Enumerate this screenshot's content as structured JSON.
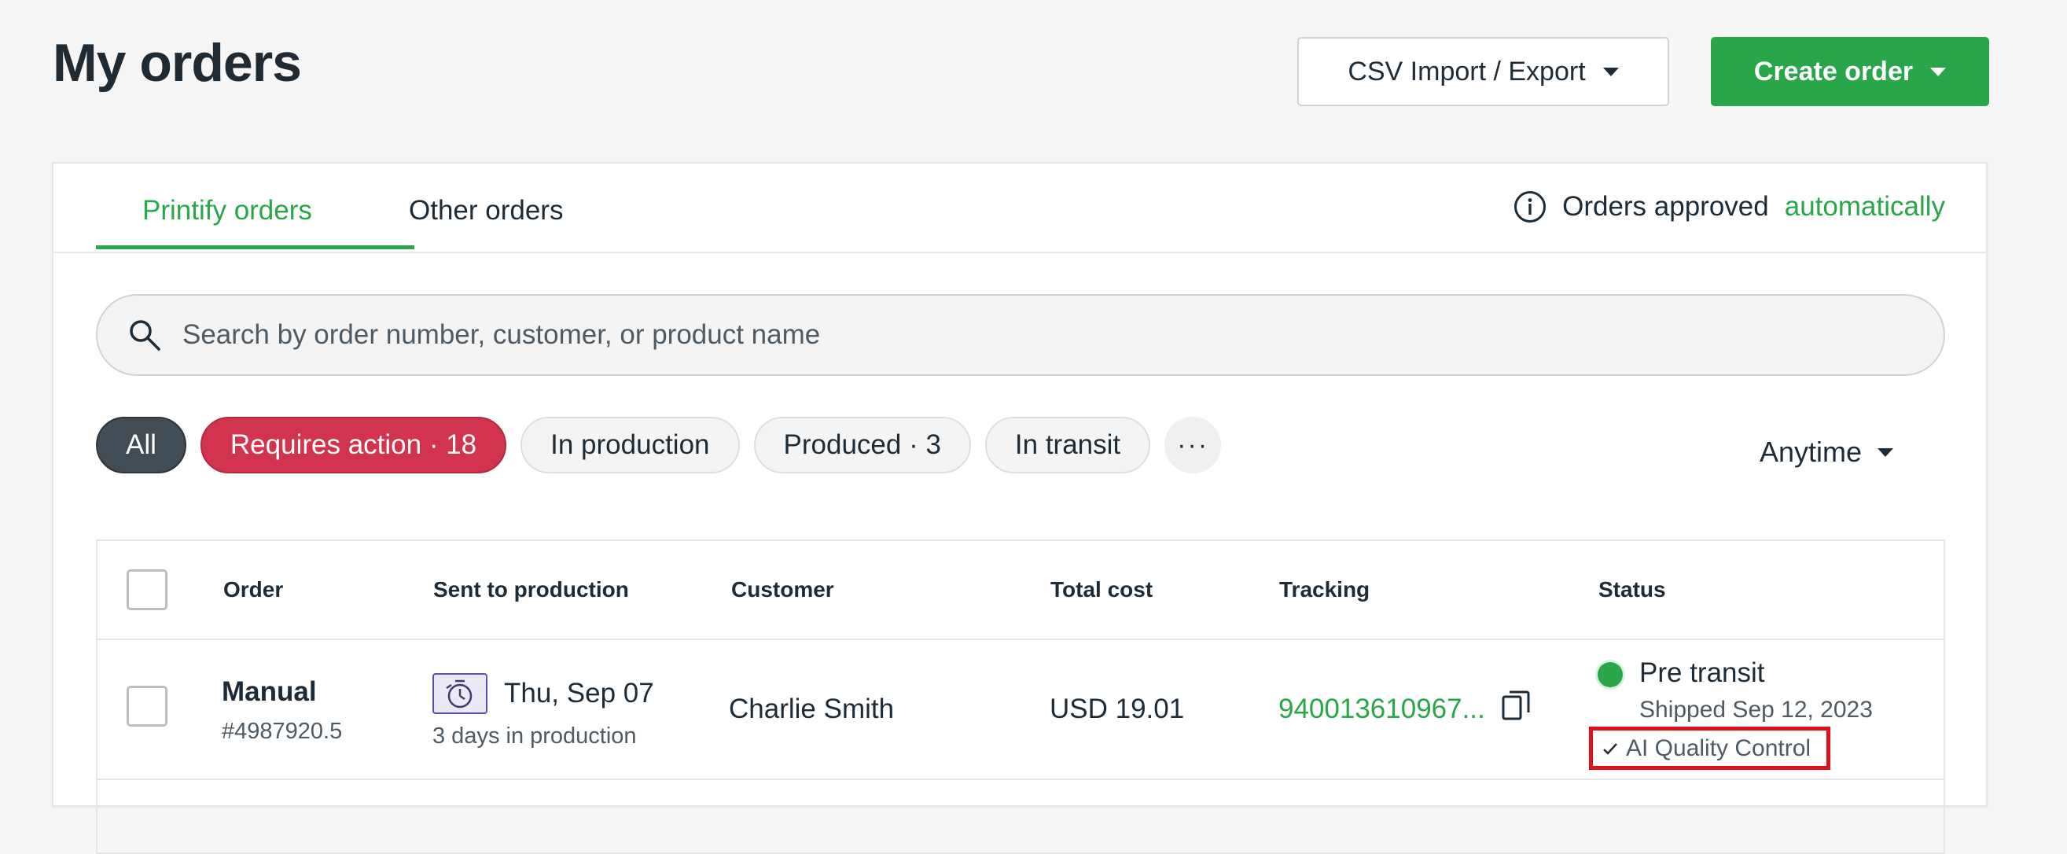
{
  "header": {
    "title": "My orders",
    "csv_button": "CSV Import / Export",
    "create_button": "Create order"
  },
  "tabs": {
    "printify": "Printify orders",
    "other": "Other orders"
  },
  "approval": {
    "prefix": "Orders approved",
    "link": "automatically"
  },
  "search": {
    "placeholder": "Search by order number, customer, or product name"
  },
  "filters": {
    "chips": [
      "All",
      "Requires action · 18",
      "In production",
      "Produced · 3",
      "In transit",
      "···"
    ],
    "date_range": "Anytime"
  },
  "table": {
    "columns": [
      "Order",
      "Sent to production",
      "Customer",
      "Total cost",
      "Tracking",
      "Status"
    ],
    "rows": [
      {
        "order_type": "Manual",
        "order_number": "#4987920.5",
        "sent_date": "Thu, Sep 07",
        "production_days": "3 days in production",
        "customer": "Charlie Smith",
        "total_cost": "USD 19.01",
        "tracking": "940013610967...",
        "status": "Pre transit",
        "status_detail": "Shipped Sep 12, 2023",
        "quality_badge": "AI Quality Control"
      }
    ]
  },
  "colors": {
    "brand_green": "#29a64a",
    "requires_action_red": "#d2334d",
    "highlight_red": "#e0101a"
  }
}
